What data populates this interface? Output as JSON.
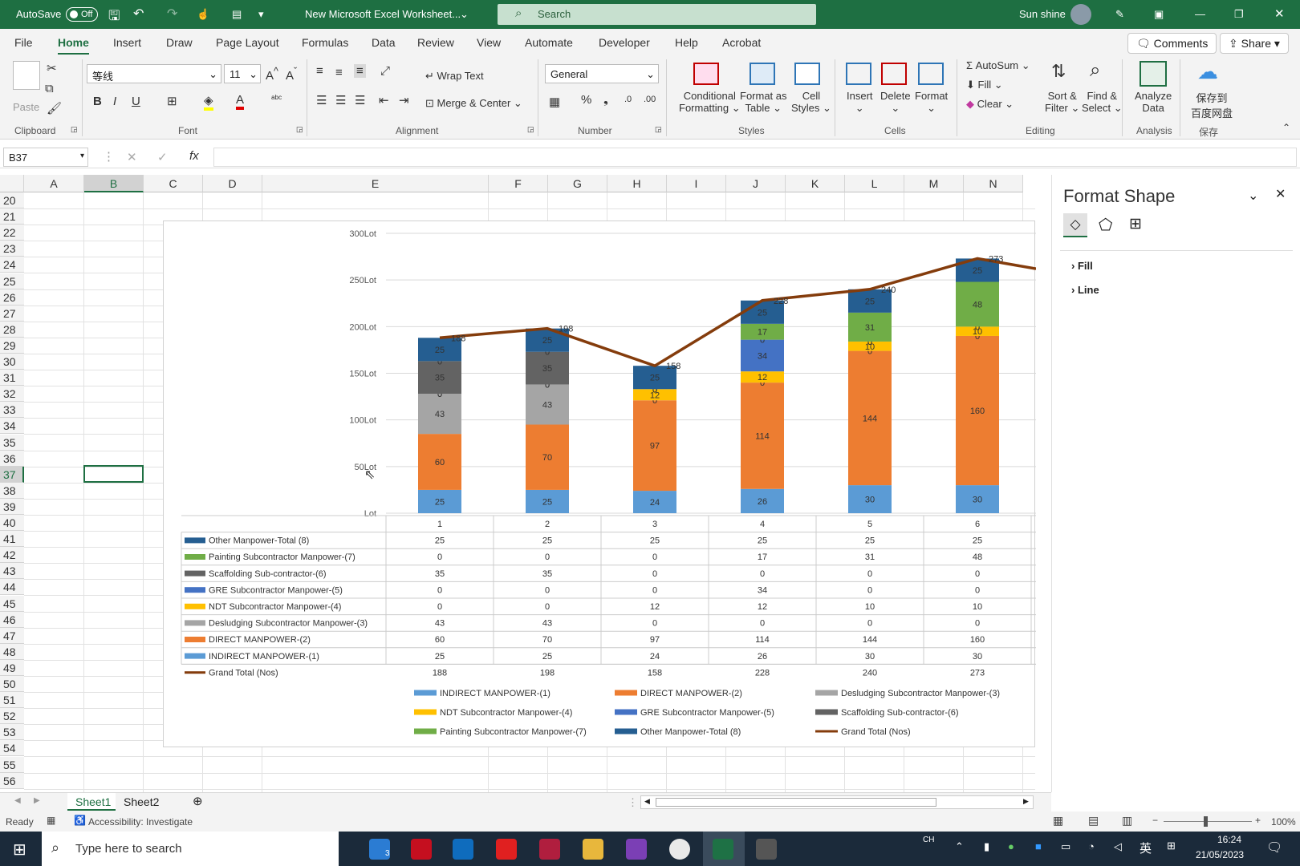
{
  "titlebar": {
    "autosave": "AutoSave",
    "autosave_state": "Off",
    "file_name": "New Microsoft Excel Worksheet...",
    "search": "Search",
    "user": "Sun shine"
  },
  "menu": {
    "tabs": [
      "File",
      "Home",
      "Insert",
      "Draw",
      "Page Layout",
      "Formulas",
      "Data",
      "Review",
      "View",
      "Automate",
      "Developer",
      "Help",
      "Acrobat"
    ],
    "comments": "Comments",
    "share": "Share"
  },
  "ribbon": {
    "paste": "Paste",
    "clipboard": "Clipboard",
    "font_name": "等线",
    "font_size": "11",
    "font": "Font",
    "wrap_text": "Wrap Text",
    "merge_center": "Merge & Center",
    "alignment": "Alignment",
    "number_format": "General",
    "number": "Number",
    "conditional": "Conditional",
    "formatting": "Formatting",
    "format_as": "Format as",
    "table": "Table",
    "cell": "Cell",
    "styles_btn": "Styles",
    "styles": "Styles",
    "insert": "Insert",
    "delete": "Delete",
    "format": "Format",
    "cells": "Cells",
    "autosum": "AutoSum",
    "fill": "Fill",
    "clear": "Clear",
    "sort": "Sort &",
    "filter": "Filter",
    "find": "Find &",
    "select": "Select",
    "editing": "Editing",
    "analyze": "Analyze",
    "data": "Data",
    "analysis": "Analysis",
    "save_baidu_1": "保存到",
    "save_baidu_2": "百度网盘",
    "save": "保存"
  },
  "formula_bar": {
    "name_box": "B37",
    "fx": "fx",
    "value": ""
  },
  "grid": {
    "columns": [
      "A",
      "B",
      "C",
      "D",
      "E",
      "F",
      "G",
      "H",
      "I",
      "J",
      "K",
      "L",
      "M",
      "N"
    ],
    "rows": [
      "20",
      "21",
      "22",
      "23",
      "24",
      "25",
      "26",
      "27",
      "28",
      "29",
      "30",
      "31",
      "32",
      "33",
      "34",
      "35",
      "36",
      "37",
      "38",
      "39",
      "40",
      "41",
      "42",
      "43",
      "44",
      "45",
      "46",
      "47",
      "48",
      "49",
      "50",
      "51",
      "52",
      "53",
      "54",
      "55",
      "56"
    ],
    "selected_cell": "B37"
  },
  "sheets": {
    "tabs": [
      "Sheet1",
      "Sheet2"
    ],
    "active": "Sheet1"
  },
  "status": {
    "ready": "Ready",
    "accessibility": "Accessibility: Investigate",
    "zoom": "100%"
  },
  "format_pane": {
    "title": "Format Shape",
    "fill": "Fill",
    "line": "Line"
  },
  "taskbar": {
    "search": "Type here to search",
    "lang": "CH",
    "ime": "英",
    "time": "16:24",
    "date": "21/05/2023",
    "notif": "3"
  },
  "colors": {
    "excel_green": "#1e6f42",
    "indirect": "#5b9bd5",
    "direct": "#ed7d31",
    "deslud": "#a5a5a5",
    "ndt": "#ffc000",
    "gre": "#4472c4",
    "scaff": "#636363",
    "paint": "#70ad47",
    "other": "#255e91",
    "total": "#843c0c"
  },
  "chart_data": {
    "type": "bar",
    "stacked": true,
    "categories": [
      "1",
      "2",
      "3",
      "4",
      "5",
      "6"
    ],
    "y_ticks": [
      "300Lot",
      "250Lot",
      "200Lot",
      "150Lot",
      "100Lot",
      "50Lot",
      "Lot"
    ],
    "ylim": [
      0,
      300
    ],
    "series": [
      {
        "name": "INDIRECT MANPOWER-(1)",
        "values": [
          25,
          25,
          24,
          26,
          30,
          30
        ],
        "color": "#5b9bd5"
      },
      {
        "name": "DIRECT MANPOWER-(2)",
        "values": [
          60,
          70,
          97,
          114,
          144,
          160
        ],
        "color": "#ed7d31"
      },
      {
        "name": "Desludging Subcontractor Manpower-(3)",
        "values": [
          43,
          43,
          0,
          0,
          0,
          0
        ],
        "color": "#a5a5a5"
      },
      {
        "name": "NDT Subcontractor Manpower-(4)",
        "values": [
          0,
          0,
          12,
          12,
          10,
          10
        ],
        "color": "#ffc000"
      },
      {
        "name": "GRE Subcontractor Manpower-(5)",
        "values": [
          0,
          0,
          0,
          34,
          0,
          0
        ],
        "color": "#4472c4"
      },
      {
        "name": "Scaffolding Sub-contractor-(6)",
        "values": [
          35,
          35,
          0,
          0,
          0,
          0
        ],
        "color": "#636363"
      },
      {
        "name": "Painting Subcontractor Manpower-(7)",
        "values": [
          0,
          0,
          0,
          17,
          31,
          48
        ],
        "color": "#70ad47"
      },
      {
        "name": "Other Manpower-Total (8)",
        "values": [
          25,
          25,
          25,
          25,
          25,
          25
        ],
        "color": "#255e91"
      }
    ],
    "line": {
      "name": "Grand Total (Nos)",
      "values": [
        188,
        198,
        158,
        228,
        240,
        273
      ],
      "color": "#843c0c"
    },
    "table_order": [
      7,
      6,
      5,
      4,
      3,
      2,
      1,
      0
    ],
    "legend": "bottom"
  }
}
